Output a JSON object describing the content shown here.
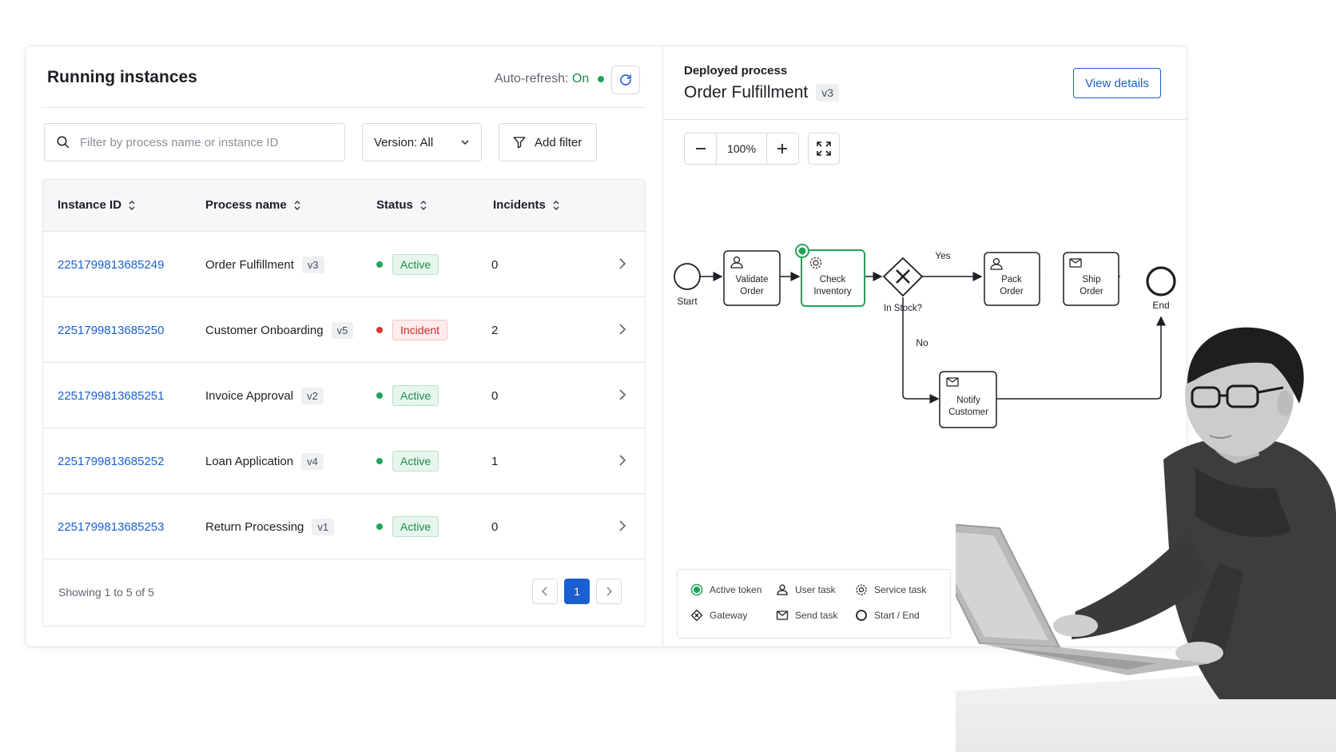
{
  "instances": {
    "title": "Running instances",
    "auto_refresh_label": "Auto-refresh:",
    "auto_refresh_value": "On",
    "search_placeholder": "Filter by process name or instance ID",
    "version_filter": "Version: All",
    "add_filter": "Add filter",
    "columns": [
      "Instance ID",
      "Process name",
      "Status",
      "Incidents"
    ],
    "rows": [
      {
        "id": "2251799813685249",
        "process": "Order Fulfillment",
        "version": "v3",
        "status": "Active",
        "incidents": "0"
      },
      {
        "id": "2251799813685250",
        "process": "Customer Onboarding",
        "version": "v5",
        "status": "Incident",
        "incidents": "2"
      },
      {
        "id": "2251799813685251",
        "process": "Invoice Approval",
        "version": "v2",
        "status": "Active",
        "incidents": "0"
      },
      {
        "id": "2251799813685252",
        "process": "Loan Application",
        "version": "v4",
        "status": "Active",
        "incidents": "1"
      },
      {
        "id": "2251799813685253",
        "process": "Return Processing",
        "version": "v1",
        "status": "Active",
        "incidents": "0"
      }
    ],
    "showing": "Showing 1 to 5 of 5",
    "current_page": "1"
  },
  "process": {
    "label": "Deployed process",
    "name": "Order Fulfillment",
    "version": "v3",
    "view_details": "View details",
    "zoom": "100%",
    "nodes": {
      "start": "Start",
      "validate_1": "Validate",
      "validate_2": "Order",
      "check_1": "Check",
      "check_2": "Inventory",
      "gateway": "In Stock?",
      "yes": "Yes",
      "no": "No",
      "pack_1": "Pack",
      "pack_2": "Order",
      "ship_1": "Ship",
      "ship_2": "Order",
      "notify_1": "Notify",
      "notify_2": "Customer",
      "end": "End"
    },
    "legend": {
      "active_token": "Active token",
      "user_task": "User task",
      "service_task": "Service task",
      "gateway": "Gateway",
      "send_task": "Send task",
      "start_end": "Start / End"
    }
  },
  "colors": {
    "accent": "#1a5fcf",
    "active": "#22a35a",
    "incident": "#d93636"
  }
}
